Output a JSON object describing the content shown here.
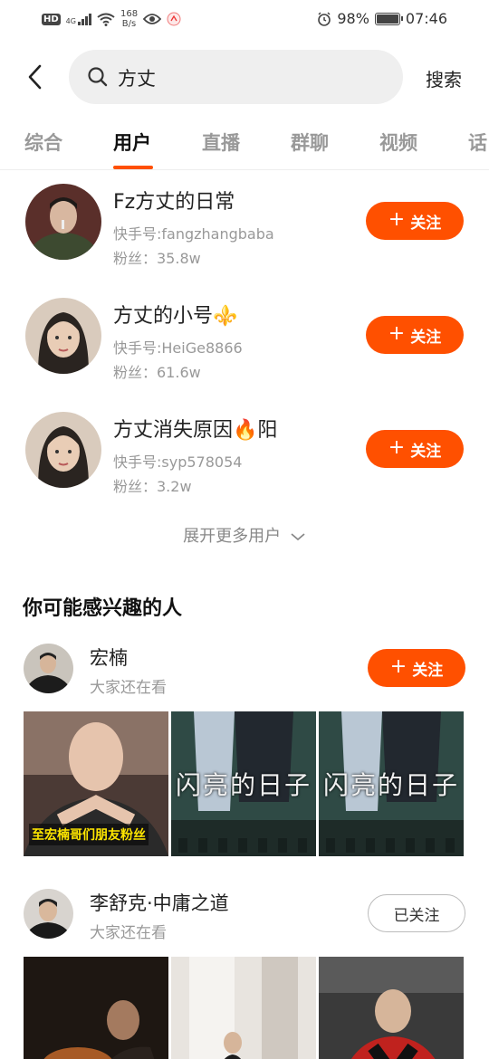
{
  "status_bar": {
    "hd": "HD",
    "network": "4G",
    "speed_top": "168",
    "speed_bottom": "B/s",
    "battery": "98%",
    "time": "07:46"
  },
  "search": {
    "query": "方丈",
    "button": "搜索"
  },
  "tabs": [
    {
      "label": "综合",
      "active": false
    },
    {
      "label": "用户",
      "active": true
    },
    {
      "label": "直播",
      "active": false
    },
    {
      "label": "群聊",
      "active": false
    },
    {
      "label": "视频",
      "active": false
    },
    {
      "label": "话",
      "active": false
    }
  ],
  "users": [
    {
      "name": "Fz方丈的日常",
      "id": "快手号:fangzhangbaba",
      "fans": "粉丝：35.8w",
      "follow": "关注"
    },
    {
      "name": "方丈的小号⚜️",
      "id": "快手号:HeiGe8866",
      "fans": "粉丝：61.6w",
      "follow": "关注"
    },
    {
      "name": "方丈消失原因🔥阳",
      "id": "快手号:syp578054",
      "fans": "粉丝：3.2w",
      "follow": "关注"
    }
  ],
  "expand_more": "展开更多用户",
  "recommend": {
    "title": "你可能感兴趣的人",
    "people": [
      {
        "name": "宏楠",
        "sub": "大家还在看",
        "button": "关注",
        "followed": false,
        "thumb_caption": "至宏楠哥们朋友粉丝",
        "thumb_overlay": "闪亮的日子"
      },
      {
        "name": "李舒克·中庸之道",
        "sub": "大家还在看",
        "button": "已关注",
        "followed": true
      }
    ]
  },
  "colors": {
    "accent": "#ff5000",
    "tab_inactive": "#999999",
    "secondary_text": "#999999"
  }
}
